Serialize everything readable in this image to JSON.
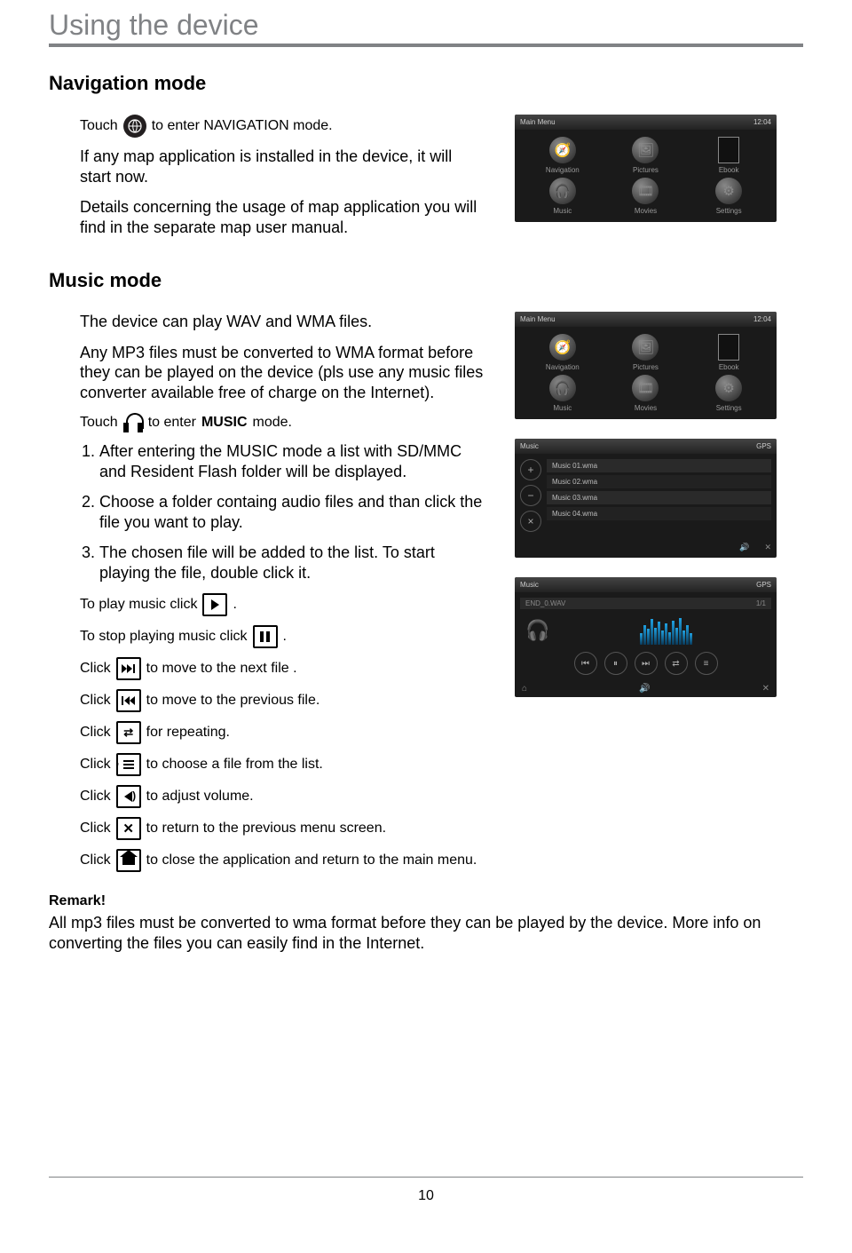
{
  "page": {
    "title": "Using the device",
    "number": "10"
  },
  "nav": {
    "heading": "Navigation mode",
    "touch1": "Touch",
    "touch2": "to enter NAVIGATION mode.",
    "p2": "If any map application is installed in the device, it will start now.",
    "p3": "Details concerning the usage of map application you will find in the separate map user manual."
  },
  "music": {
    "heading": "Music mode",
    "p1": "The device can play WAV and WMA files.",
    "p2": "Any MP3 files must be converted to WMA format before they can be played on the device (pls use any music files converter available free of charge on the Internet).",
    "touch1": "Touch",
    "touch2": "to enter",
    "touch3": "MUSIC",
    "touch4": "mode.",
    "li1": "After entering the MUSIC mode a list with SD/MMC and Resident Flash folder will be displayed.",
    "li2": "Choose a folder containg audio files and than click the file you want to play.",
    "li3": "The chosen file will be added to the list. To start playing the file, double click it.",
    "play1": "To play music click",
    "stop1": "To stop playing music click",
    "click": "Click",
    "next": "to move to the next file .",
    "prev": "to move to the previous  file.",
    "rep": "for repeating.",
    "choose": "to choose a file from the list.",
    "vol": "to adjust volume.",
    "retp": "to return to the previous menu screen.",
    "close": "to close the application and return to the main menu.",
    "dot": "."
  },
  "remark": {
    "heading": "Remark!",
    "body": "All mp3 files must be converted to wma format before they can be played by the device. More info on converting the files you can easily find in the Internet."
  },
  "shots": {
    "bar1": "Main Menu",
    "time": "12:04",
    "m": [
      "Navigation",
      "Pictures",
      "Ebook",
      "Music",
      "Movies",
      "Settings"
    ],
    "bar2": "Music",
    "gps": "GPS",
    "files": [
      "Music 01.wma",
      "Music 02.wma",
      "Music 03.wma",
      "Music 04.wma"
    ],
    "track": "END_0.WAV",
    "tracknum": "1/1"
  }
}
